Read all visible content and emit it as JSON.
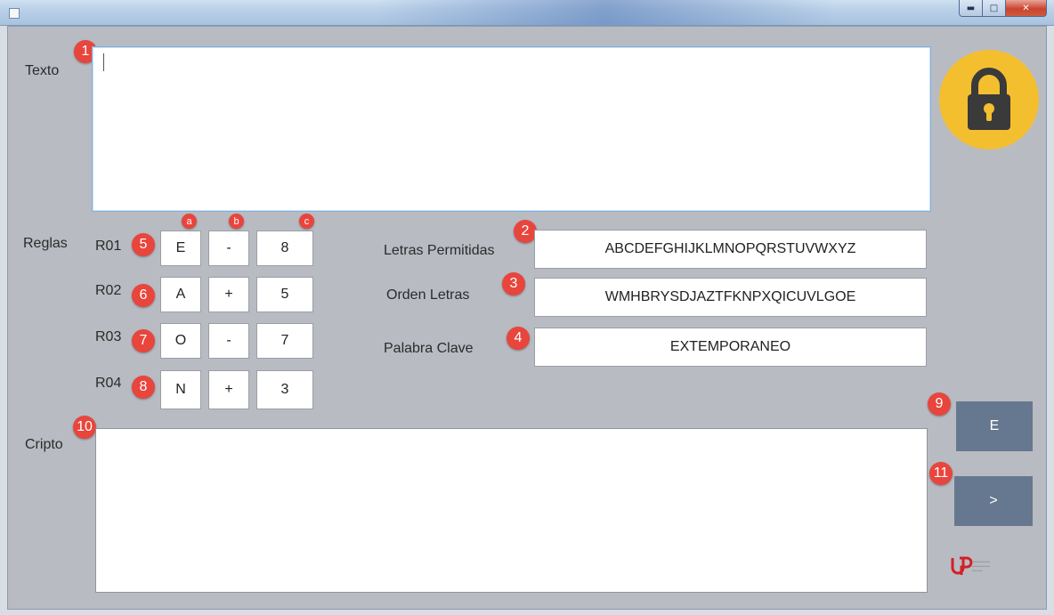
{
  "labels": {
    "texto": "Texto",
    "reglas": "Reglas",
    "cripto": "Cripto",
    "letras_permitidas": "Letras Permitidas",
    "orden_letras": "Orden Letras",
    "palabra_clave": "Palabra Clave"
  },
  "inputs": {
    "texto_value": "",
    "cripto_value": "",
    "letras_permitidas_value": "ABCDEFGHIJKLMNOPQRSTUVWXYZ",
    "orden_letras_value": "WMHBRYSDJAZTFKNPXQICUVLGOE",
    "palabra_clave_value": "EXTEMPORANEO"
  },
  "rules": [
    {
      "label": "R01",
      "letter": "E",
      "op": "-",
      "num": "8",
      "badge": "5"
    },
    {
      "label": "R02",
      "letter": "A",
      "op": "+",
      "num": "5",
      "badge": "6"
    },
    {
      "label": "R03",
      "letter": "O",
      "op": "-",
      "num": "7",
      "badge": "7"
    },
    {
      "label": "R04",
      "letter": "N",
      "op": "+",
      "num": "3",
      "badge": "8"
    }
  ],
  "column_badges": {
    "a": "a",
    "b": "b",
    "c": "c"
  },
  "badges": {
    "texto": "1",
    "letras_permitidas": "2",
    "orden_letras": "3",
    "palabra_clave": "4",
    "encrypt": "9",
    "cripto": "10",
    "next": "11"
  },
  "buttons": {
    "encrypt_label": "E",
    "next_label": ">"
  },
  "icons": {
    "window": "app-icon",
    "lock": "padlock-icon",
    "logo": "utp-logo"
  },
  "colors": {
    "badge": "#e8453c",
    "button": "#66788f",
    "lock": "#f4bf2e",
    "client_bg": "#b9bbc2",
    "logo": "#d32027"
  }
}
